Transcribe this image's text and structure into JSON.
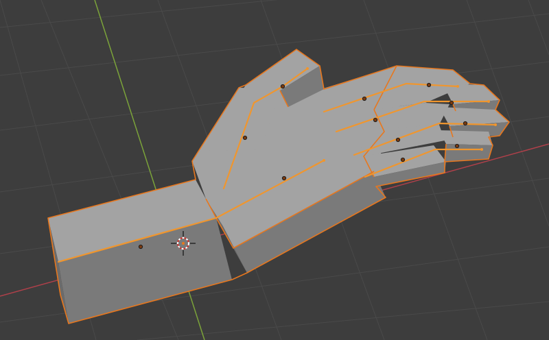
{
  "viewport": {
    "mode": "3D Viewport",
    "background_color": "#3d3d3d",
    "grid_color": "#4a4a4a",
    "x_axis_color": "#b0404a",
    "y_axis_color": "#7ba33a",
    "selection_outline_color": "#e8771d",
    "bone_color": "#f0962e"
  },
  "scene": {
    "object": "hand-mesh",
    "selected": true,
    "armature_visible": true
  },
  "icons": {
    "cursor": "3d-cursor-icon"
  }
}
